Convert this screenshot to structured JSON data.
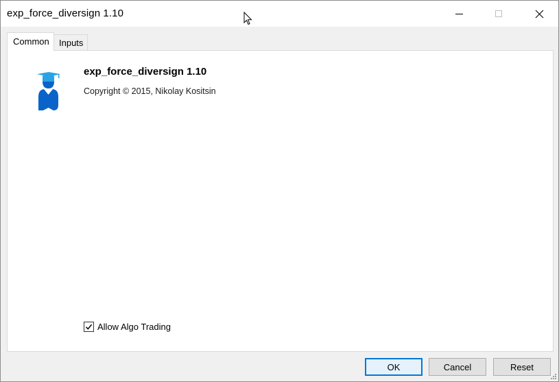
{
  "window": {
    "title": "exp_force_diversign 1.10"
  },
  "caption_buttons": [
    "minimize",
    "maximize",
    "close"
  ],
  "tabs": [
    {
      "label": "Common",
      "active": true
    },
    {
      "label": "Inputs",
      "active": false
    }
  ],
  "program": {
    "icon": "graduate-icon",
    "name": "exp_force_diversign 1.10",
    "copyright": "Copyright © 2015, Nikolay Kositsin"
  },
  "algo_trading": {
    "label": "Allow Algo Trading",
    "checked": true
  },
  "buttons": {
    "ok": "OK",
    "cancel": "Cancel",
    "reset": "Reset"
  },
  "colors": {
    "focus_accent": "#0078d7",
    "icon_light": "#29a3e6",
    "icon_dark": "#0a63c9"
  }
}
